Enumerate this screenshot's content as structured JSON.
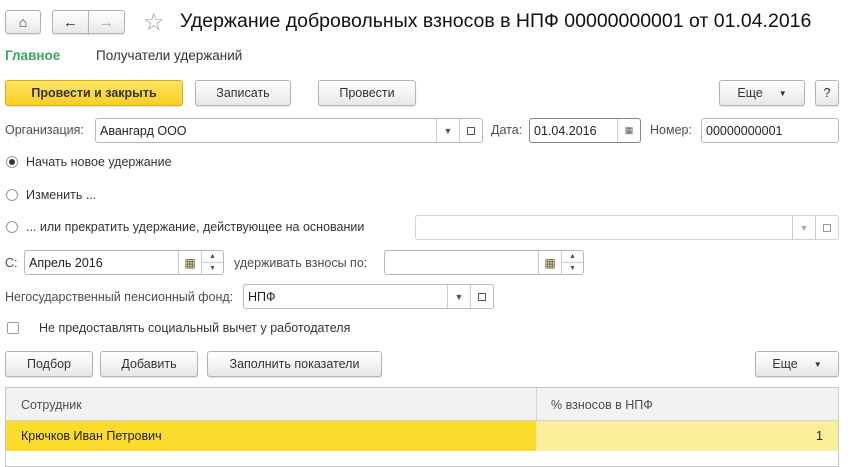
{
  "window": {
    "title": "Удержание добровольных взносов в НПФ 00000000001 от 01.04.2016"
  },
  "tabs": [
    {
      "label": "Главное",
      "active": true
    },
    {
      "label": "Получатели удержаний"
    }
  ],
  "toolbar": {
    "post_close": "Провести и закрыть",
    "save": "Записать",
    "post": "Провести",
    "more": "Еще",
    "help": "?"
  },
  "form": {
    "org_label": "Организация:",
    "org_value": "Авангард ООО",
    "date_label": "Дата:",
    "date_value": "01.04.2016",
    "number_label": "Номер:",
    "number_value": "00000000001",
    "radio_new": "Начать новое удержание",
    "radio_change": "Изменить ...",
    "radio_stop": "... или прекратить удержание, действующее на основании",
    "from_label": "С:",
    "from_value": "Апрель 2016",
    "until_label": "удерживать взносы по:",
    "until_value": "",
    "fund_label": "Негосударственный пенсионный фонд:",
    "fund_value": "НПФ",
    "no_deduction_label": "Не предоставлять социальный вычет у работодателя"
  },
  "table_toolbar": {
    "pick": "Подбор",
    "add": "Добавить",
    "fill": "Заполнить показатели",
    "more": "Еще"
  },
  "table": {
    "columns": [
      "Сотрудник",
      "% взносов в НПФ"
    ],
    "rows": [
      {
        "employee": "Крючков Иван Петрович",
        "percent": "1"
      }
    ]
  },
  "colors": {
    "accent": "#f9cf1f",
    "tab_active": "#3aa35e",
    "row_selected": "#fbdb2b",
    "row_selected_light": "#fcef9c"
  }
}
